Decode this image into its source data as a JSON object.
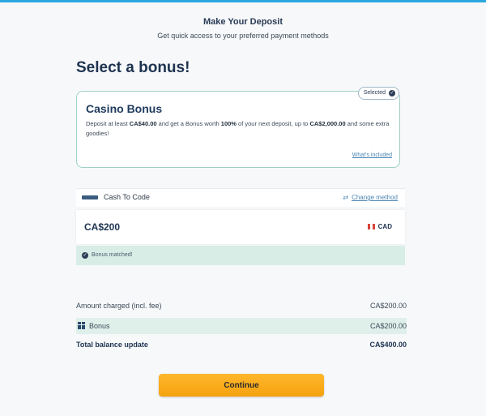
{
  "header": {
    "title": "Make Your Deposit",
    "subtitle": "Get quick access to your preferred payment methods"
  },
  "bonus_section": {
    "heading": "Select a bonus!",
    "card": {
      "badge": "Selected",
      "title": "Casino Bonus",
      "desc_1": "Deposit at least ",
      "desc_min": "CA$40.00",
      "desc_2": " and get a Bonus worth ",
      "desc_pct": "100%",
      "desc_3": " of your next deposit, up to ",
      "desc_max": "CA$2,000.00",
      "desc_4": " and some extra goodies!",
      "link": "What's included"
    }
  },
  "payment": {
    "method_name": "Cash To Code",
    "change_label": "Change method",
    "amount": "CA$200",
    "currency": "CAD",
    "bonus_matched": "Bonus matched!"
  },
  "summary": {
    "amount_charged_label": "Amount charged (incl. fee)",
    "amount_charged_value": "CA$200.00",
    "bonus_label": "Bonus",
    "bonus_value": "CA$200.00",
    "total_label": "Total balance update",
    "total_value": "CA$400.00"
  },
  "continue_label": "Continue",
  "colors": {
    "accent_blue": "#29a8e0",
    "button_orange": "#f5a20f",
    "selected_border": "#9fd0c5",
    "highlight_green": "#d9ede7"
  }
}
